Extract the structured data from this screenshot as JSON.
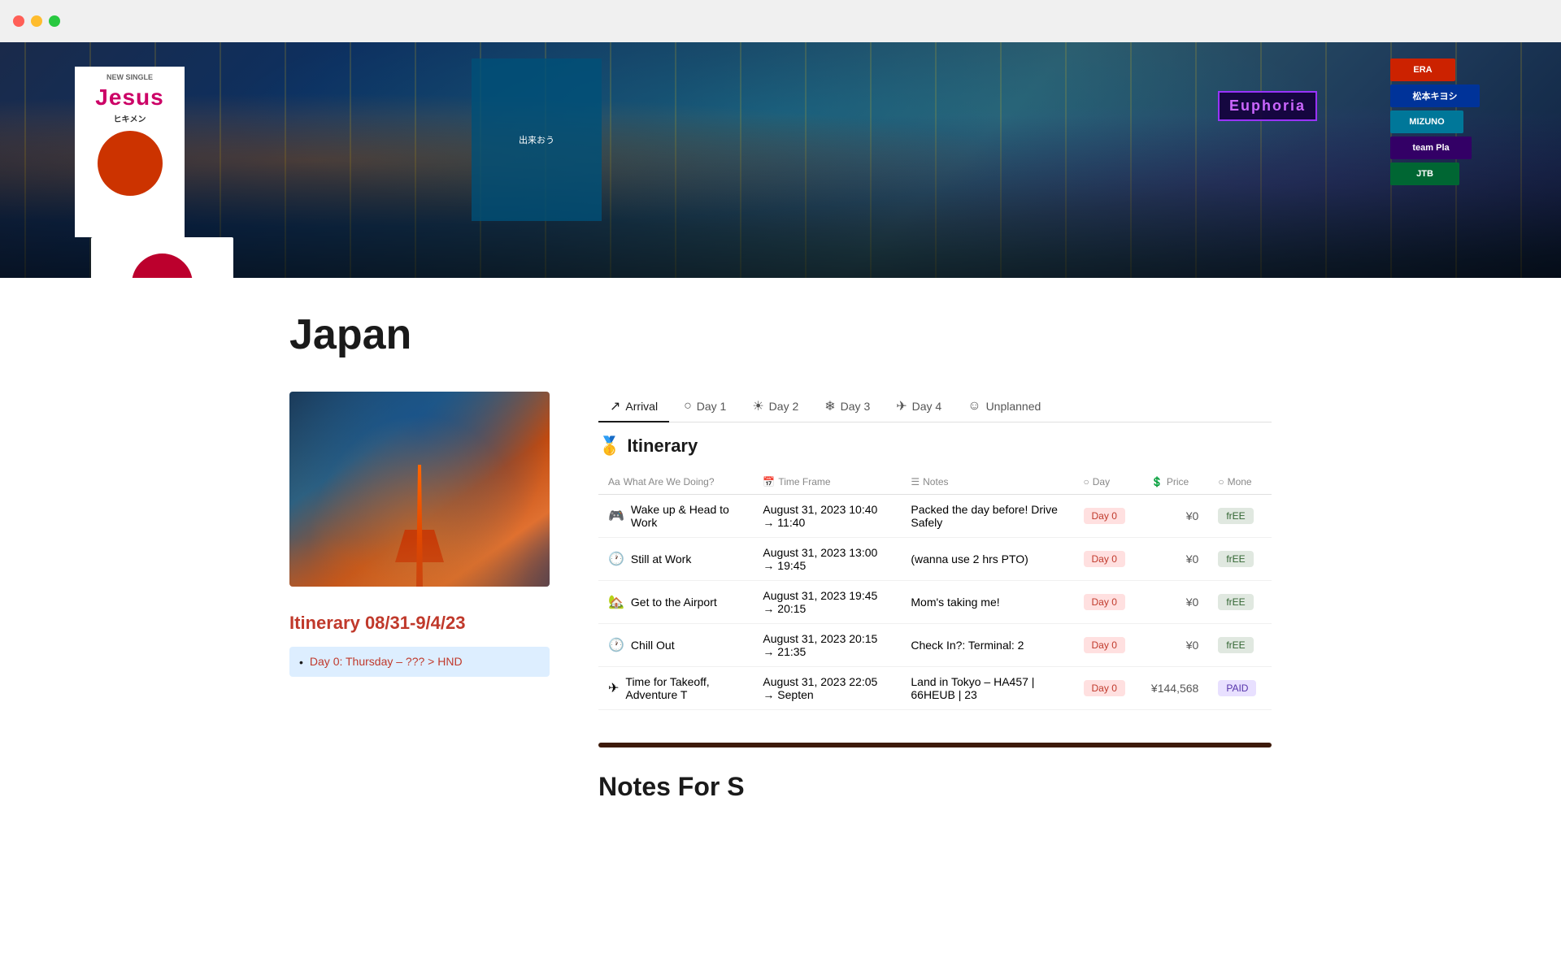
{
  "titlebar": {
    "traffic_lights": [
      "red",
      "yellow",
      "green"
    ]
  },
  "hero": {
    "billboard_text": "Jesus",
    "billboard_subtitle": "NEW SINGLE",
    "billboard_subtitle2": "ヒキメン"
  },
  "page": {
    "title": "Japan"
  },
  "sidebar": {
    "itinerary_label": "Itinerary ",
    "itinerary_dates": "08/31-9/4/23",
    "days": [
      {
        "label": "Day 0: Thursday – ??? > HND"
      }
    ]
  },
  "tabs": [
    {
      "icon": "✈",
      "label": "Arrival",
      "active": true
    },
    {
      "icon": "○",
      "label": "Day 1",
      "active": false
    },
    {
      "icon": "☀",
      "label": "Day 2",
      "active": false
    },
    {
      "icon": "❄",
      "label": "Day 3",
      "active": false
    },
    {
      "icon": "✈",
      "label": "Day 4",
      "active": false
    },
    {
      "icon": "☺",
      "label": "Unplanned",
      "active": false
    }
  ],
  "table": {
    "title": "🥇 Itinerary",
    "columns": [
      {
        "key": "activity",
        "label": "What Are We Doing?",
        "icon": "📝"
      },
      {
        "key": "timeframe",
        "label": "Time Frame",
        "icon": "📅"
      },
      {
        "key": "notes",
        "label": "Notes",
        "icon": "☰"
      },
      {
        "key": "day",
        "label": "Day",
        "icon": "○"
      },
      {
        "key": "price",
        "label": "Price",
        "icon": "💲"
      },
      {
        "key": "money",
        "label": "Mone",
        "icon": "○"
      }
    ],
    "rows": [
      {
        "icon": "🎮",
        "activity": "Wake up & Head to Work",
        "timeframe": "August 31, 2023 10:40 → 11:40",
        "notes": "Packed the day before! Drive Safely",
        "day": "Day 0",
        "price": "¥0",
        "money": "frEE",
        "money_type": "free"
      },
      {
        "icon": "🕐",
        "activity": "Still at Work",
        "timeframe": "August 31, 2023 13:00 → 19:45",
        "notes": "(wanna use 2 hrs PTO)",
        "day": "Day 0",
        "price": "¥0",
        "money": "frEE",
        "money_type": "free"
      },
      {
        "icon": "🏡",
        "activity": "Get to the Airport",
        "timeframe": "August 31, 2023 19:45 → 20:15",
        "notes": "Mom's taking me!",
        "day": "Day 0",
        "price": "¥0",
        "money": "frEE",
        "money_type": "free"
      },
      {
        "icon": "🕐",
        "activity": "Chill Out",
        "timeframe": "August 31, 2023 20:15 → 21:35",
        "notes": "Check In?: Terminal: 2",
        "day": "Day 0",
        "price": "¥0",
        "money": "frEE",
        "money_type": "free"
      },
      {
        "icon": "✈",
        "activity": "Time for Takeoff, Adventure T",
        "timeframe": "August 31, 2023 22:05 → Septen",
        "notes": "Land in Tokyo – HA457 | 66HEUB | 23",
        "day": "Day 0",
        "price": "¥144,568",
        "money": "PAID",
        "money_type": "paid"
      }
    ]
  },
  "notes_section": {
    "title": "Notes For S"
  }
}
